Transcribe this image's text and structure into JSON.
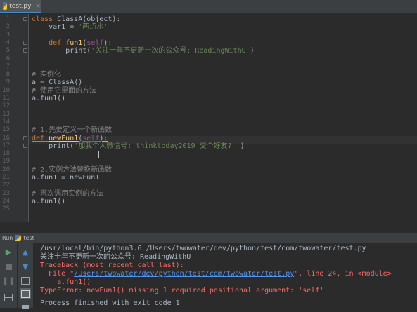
{
  "tab": {
    "label": "test.py",
    "close": "×"
  },
  "editor": {
    "line_numbers": [
      "1",
      "2",
      "3",
      "4",
      "5",
      "6",
      "7",
      "8",
      "9",
      "10",
      "11",
      "12",
      "13",
      "14",
      "15",
      "16",
      "17",
      "18",
      "19",
      "20",
      "21",
      "22",
      "23",
      "24",
      "25"
    ],
    "lines": [
      [
        {
          "t": "class ",
          "c": "kw"
        },
        {
          "t": "ClassA(object):",
          "c": ""
        }
      ],
      [
        {
          "t": "    var1 = ",
          "c": ""
        },
        {
          "t": "'两点水'",
          "c": "str"
        }
      ],
      [],
      [
        {
          "t": "    ",
          "c": ""
        },
        {
          "t": "def ",
          "c": "kw"
        },
        {
          "t": "fun1",
          "c": "fn ul"
        },
        {
          "t": "(",
          "c": ""
        },
        {
          "t": "self",
          "c": "self"
        },
        {
          "t": "):",
          "c": ""
        }
      ],
      [
        {
          "t": "        print(",
          "c": ""
        },
        {
          "t": "'关注十年不更新一次的公众号: ReadingWithU'",
          "c": "str"
        },
        {
          "t": ")",
          "c": ""
        }
      ],
      [],
      [],
      [
        {
          "t": "# 实例化",
          "c": "cm"
        }
      ],
      [
        {
          "t": "a = ClassA()",
          "c": ""
        }
      ],
      [
        {
          "t": "# 使用它里面的方法",
          "c": "cm"
        }
      ],
      [
        {
          "t": "a.fun1()",
          "c": ""
        }
      ],
      [],
      [],
      [],
      [
        {
          "t": "# 1.先要定义一个新函数",
          "c": "cm ul"
        }
      ],
      [
        {
          "t": "def ",
          "c": "kw ul"
        },
        {
          "t": "newFun1",
          "c": "fn ul"
        },
        {
          "t": "(",
          "c": "ul"
        },
        {
          "t": "self",
          "c": "self ul"
        },
        {
          "t": "):",
          "c": "ul"
        }
      ],
      [
        {
          "t": "    print(",
          "c": ""
        },
        {
          "t": "'加我个人微信号: ",
          "c": "str"
        },
        {
          "t": "thinktoday",
          "c": "str ul"
        },
        {
          "t": "2019 交个好友? '",
          "c": "str"
        },
        {
          "t": ")",
          "c": ""
        }
      ],
      [],
      [],
      [
        {
          "t": "# 2.实例方法替换新函数",
          "c": "cm"
        }
      ],
      [
        {
          "t": "a.fun1 = newFun1",
          "c": ""
        }
      ],
      [],
      [
        {
          "t": "# 再次调用实例的方法",
          "c": "cm"
        }
      ],
      [
        {
          "t": "a.fun1()",
          "c": ""
        }
      ],
      []
    ]
  },
  "run": {
    "label": "Run",
    "config": "test"
  },
  "console": {
    "line1": "/usr/local/bin/python3.6 /Users/twowater/dev/python/test/com/twowater/test.py",
    "line2": "关注十年不更新一次的公众号: ReadingWithU",
    "line3": "Traceback (most recent call last):",
    "line4_pre": "  File \"",
    "line4_link": "/Users/twowater/dev/python/test/com/twowater/test.py",
    "line4_post": "\", line 24, in <module>",
    "line5": "    a.fun1()",
    "line6": "TypeError: newFun1() missing 1 required positional argument: 'self'",
    "line7": "Process finished with exit code 1"
  },
  "colors": {
    "accent": "#4a88c7",
    "error": "#ff6b68",
    "link": "#5394ec",
    "run_green": "#59a869"
  }
}
